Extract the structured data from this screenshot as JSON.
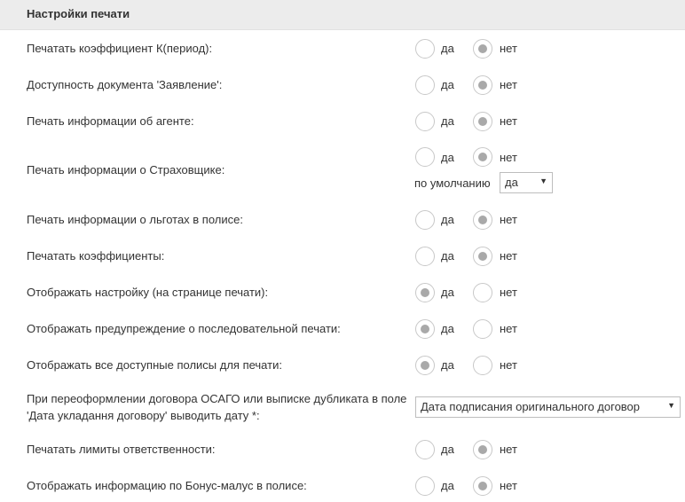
{
  "section_title": "Настройки печати",
  "labels": {
    "yes": "да",
    "no": "нет",
    "default": "по умолчанию"
  },
  "settings": [
    {
      "label": "Печатать коэффициент К(период):",
      "selected": "no"
    },
    {
      "label": "Доступность документа 'Заявление':",
      "selected": "no"
    },
    {
      "label": "Печать информации об агенте:",
      "selected": "no"
    },
    {
      "label": "Печать информации о Страховщике:",
      "selected": "no",
      "default_value": "да"
    },
    {
      "label": "Печать информации о льготах в полисе:",
      "selected": "no"
    },
    {
      "label": "Печатать коэффициенты:",
      "selected": "no"
    },
    {
      "label": "Отображать настройку (на странице печати):",
      "selected": "yes"
    },
    {
      "label": "Отображать предупреждение о последовательной печати:",
      "selected": "yes"
    },
    {
      "label": "Отображать все доступные полисы для печати:",
      "selected": "yes"
    },
    {
      "label": "При переоформлении договора ОСАГО или выписке дубликата в поле 'Дата укладання договору' выводить дату *:",
      "select_value": "Дата подписания оригинального договор"
    },
    {
      "label": "Печатать лимиты ответственности:",
      "selected": "no"
    },
    {
      "label": "Отображать информацию по Бонус-малус в полисе:",
      "selected": "no"
    }
  ]
}
